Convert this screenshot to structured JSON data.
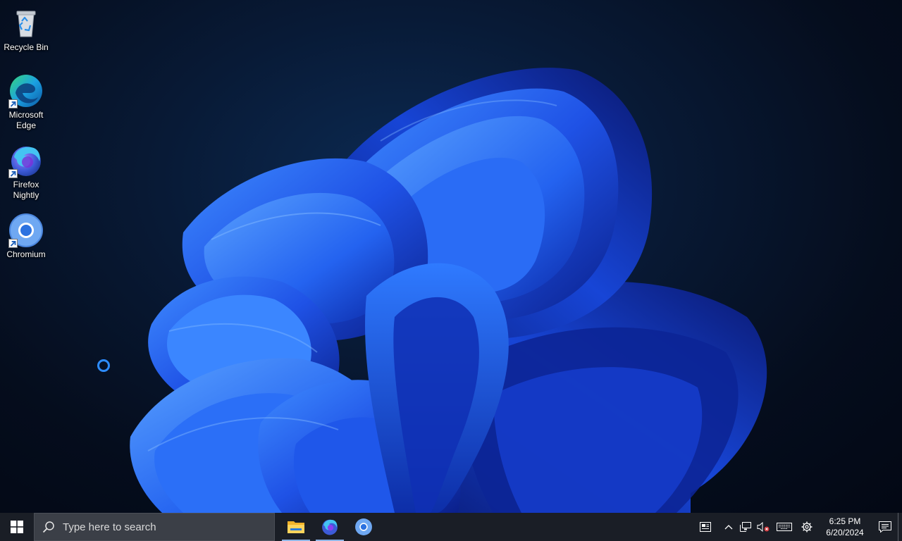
{
  "desktop": {
    "icons": [
      {
        "label": "Recycle Bin",
        "icon": "recycle-bin-icon"
      },
      {
        "label": "Microsoft\nEdge",
        "icon": "edge-icon"
      },
      {
        "label": "Firefox\nNightly",
        "icon": "firefox-nightly-icon"
      },
      {
        "label": "Chromium",
        "icon": "chromium-icon"
      }
    ]
  },
  "taskbar": {
    "search_placeholder": "Type here to search",
    "pinned_apps": [
      {
        "name": "File Explorer",
        "icon": "folder-icon"
      },
      {
        "name": "Firefox Nightly",
        "icon": "firefox-nightly-icon"
      },
      {
        "name": "Chromium",
        "icon": "chromium-icon"
      }
    ],
    "tray": {
      "icons": [
        "news-icon",
        "chevron-up-icon",
        "network-icon",
        "speaker-muted-icon",
        "keyboard-icon",
        "gear-icon"
      ],
      "time": "6:25 PM",
      "date": "6/20/2024"
    }
  },
  "colors": {
    "taskbar_bg": "#1a1e26",
    "search_bg": "#3b3f47",
    "accent": "#2f6fdb"
  }
}
